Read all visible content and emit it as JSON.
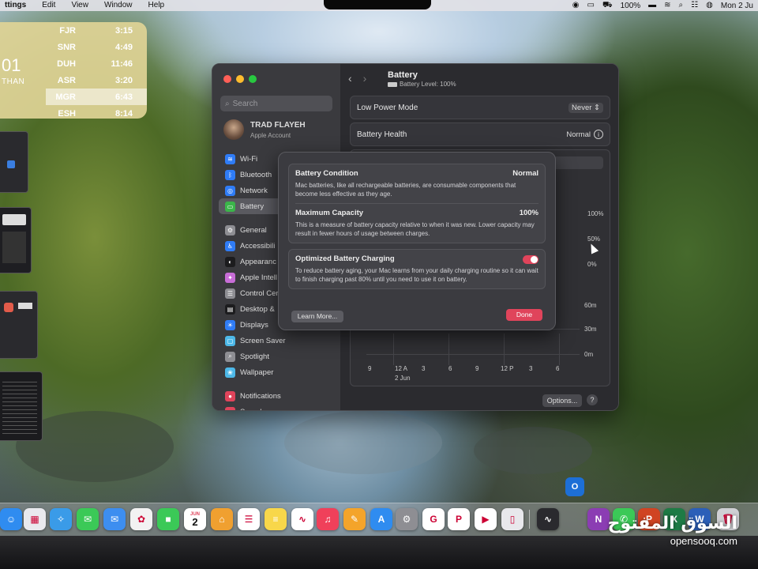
{
  "menubar": {
    "app_name": "ttings",
    "items": [
      "Edit",
      "View",
      "Window",
      "Help"
    ],
    "battery_pct": "100%",
    "clock": "Mon 2 Ju"
  },
  "prayer_widget": {
    "current_time": "01",
    "current_label": "THAN",
    "rows": [
      {
        "name": "FJR",
        "time": "3:15"
      },
      {
        "name": "SNR",
        "time": "4:49"
      },
      {
        "name": "DUH",
        "time": "11:46"
      },
      {
        "name": "ASR",
        "time": "3:20"
      },
      {
        "name": "MGR",
        "time": "6:43"
      },
      {
        "name": "ESH",
        "time": "8:14"
      }
    ]
  },
  "sidebar": {
    "search_placeholder": "Search",
    "account": {
      "name": "TRAD FLAYEH",
      "subtitle": "Apple Account"
    },
    "group1": [
      {
        "label": "Wi-Fi",
        "color": "#2f7cf6",
        "icon": "wifi-icon",
        "glyph": "≋"
      },
      {
        "label": "Bluetooth",
        "color": "#2f7cf6",
        "icon": "bluetooth-icon",
        "glyph": "ᛒ"
      },
      {
        "label": "Network",
        "color": "#2f7cf6",
        "icon": "globe-icon",
        "glyph": "◎"
      },
      {
        "label": "Battery",
        "color": "#3bb54a",
        "icon": "battery-icon",
        "glyph": "▭"
      }
    ],
    "group2": [
      {
        "label": "General",
        "color": "#8e8e93",
        "icon": "gear-icon",
        "glyph": "⚙"
      },
      {
        "label": "Accessibili",
        "color": "#2f7cf6",
        "icon": "accessibility-icon",
        "glyph": "♿"
      },
      {
        "label": "Appearanc",
        "color": "#1c1c1e",
        "icon": "appearance-icon",
        "glyph": "◐"
      },
      {
        "label": "Apple Intell",
        "color": "#c86dd7",
        "icon": "apple-intelligence-icon",
        "glyph": "✦"
      },
      {
        "label": "Control Cer",
        "color": "#8e8e93",
        "icon": "control-center-icon",
        "glyph": "☰"
      },
      {
        "label": "Desktop &",
        "color": "#1c1c1e",
        "icon": "desktop-icon",
        "glyph": "▤"
      },
      {
        "label": "Displays",
        "color": "#2f7cf6",
        "icon": "display-icon",
        "glyph": "☀"
      },
      {
        "label": "Screen Saver",
        "color": "#4db8e8",
        "icon": "screen-saver-icon",
        "glyph": "▢"
      },
      {
        "label": "Spotlight",
        "color": "#8e8e93",
        "icon": "spotlight-icon",
        "glyph": "⌕"
      },
      {
        "label": "Wallpaper",
        "color": "#4db8e8",
        "icon": "wallpaper-icon",
        "glyph": "❀"
      }
    ],
    "group3": [
      {
        "label": "Notifications",
        "color": "#e0445b",
        "icon": "notifications-icon",
        "glyph": "●"
      },
      {
        "label": "Sound",
        "color": "#e0445b",
        "icon": "sound-icon",
        "glyph": "♪"
      }
    ]
  },
  "pane": {
    "title": "Battery",
    "subtitle": "Battery Level: 100%",
    "low_power_label": "Low Power Mode",
    "low_power_value": "Never",
    "health_label": "Battery Health",
    "health_value": "Normal",
    "segment_fragment": "s",
    "y_pct": [
      "100%",
      "50%",
      "0%"
    ],
    "y_time": [
      "60m",
      "30m",
      "0m"
    ],
    "x_ticks": [
      "9",
      "12 A",
      "3",
      "6",
      "9",
      "12 P",
      "3",
      "6"
    ],
    "x_date": "2 Jun",
    "options_label": "Options...",
    "help_label": "?"
  },
  "modal": {
    "condition_title": "Battery Condition",
    "condition_value": "Normal",
    "condition_desc": "Mac batteries, like all rechargeable batteries, are consumable components that become less effective as they age.",
    "capacity_title": "Maximum Capacity",
    "capacity_value": "100%",
    "capacity_desc": "This is a measure of battery capacity relative to when it was new. Lower capacity may result in fewer hours of usage between charges.",
    "optimized_title": "Optimized Battery Charging",
    "optimized_on": true,
    "optimized_desc": "To reduce battery aging, your Mac learns from your daily charging routine so it can wait to finish charging past 80% until you need to use it on battery.",
    "learn_more": "Learn More...",
    "done": "Done"
  },
  "dock": {
    "calendar_month": "JUN",
    "calendar_day": "2",
    "apps": [
      {
        "name": "finder-icon",
        "color": "#2f8cf0",
        "glyph": "☺"
      },
      {
        "name": "launchpad-icon",
        "color": "#e9e9ee",
        "glyph": "▦"
      },
      {
        "name": "safari-icon",
        "color": "#3a9be8",
        "glyph": "✧"
      },
      {
        "name": "messages-icon",
        "color": "#3bc957",
        "glyph": "✉"
      },
      {
        "name": "mail-icon",
        "color": "#3d8ef0",
        "glyph": "✉"
      },
      {
        "name": "photos-icon",
        "color": "#f2f2f2",
        "glyph": "✿"
      },
      {
        "name": "facetime-icon",
        "color": "#3bc957",
        "glyph": "■"
      },
      {
        "name": "calendar-icon",
        "color": "#ffffff",
        "glyph": ""
      },
      {
        "name": "home-icon",
        "color": "#f0a030",
        "glyph": "⌂"
      },
      {
        "name": "reminders-icon",
        "color": "#ffffff",
        "glyph": "☰"
      },
      {
        "name": "notes-icon",
        "color": "#f8d74a",
        "glyph": "≡"
      },
      {
        "name": "freeform-icon",
        "color": "#ffffff",
        "glyph": "∿"
      },
      {
        "name": "music-icon",
        "color": "#f0405a",
        "glyph": "♫"
      },
      {
        "name": "pages-icon",
        "color": "#f4a42a",
        "glyph": "✎"
      },
      {
        "name": "app-store-icon",
        "color": "#2f8cf0",
        "glyph": "A"
      },
      {
        "name": "system-settings-icon",
        "color": "#8e8e93",
        "glyph": "⚙"
      },
      {
        "name": "chrome-icon",
        "color": "#ffffff",
        "glyph": "G"
      },
      {
        "name": "pinterest-icon",
        "color": "#ffffff",
        "glyph": "P"
      },
      {
        "name": "youtube-icon",
        "color": "#ffffff",
        "glyph": "▶"
      },
      {
        "name": "preview-icon",
        "color": "#e8e8ec",
        "glyph": "▯"
      },
      {
        "name": "activity-monitor-icon",
        "color": "#2a2a2e",
        "glyph": "∿"
      },
      {
        "name": "onenote-icon",
        "color": "#8b3db3",
        "glyph": "N"
      },
      {
        "name": "whatsapp-icon",
        "color": "#3bc957",
        "glyph": "✆"
      },
      {
        "name": "powerpoint-icon",
        "color": "#d04423",
        "glyph": "P"
      },
      {
        "name": "excel-icon",
        "color": "#1e7b45",
        "glyph": "X"
      },
      {
        "name": "word-icon",
        "color": "#2b5fb8",
        "glyph": "W"
      },
      {
        "name": "trash-icon",
        "color": "#cfd0d4",
        "glyph": "🗑"
      }
    ]
  },
  "watermark": {
    "arabic": "السوق المفتوح",
    "latin": "opensooq.com"
  }
}
